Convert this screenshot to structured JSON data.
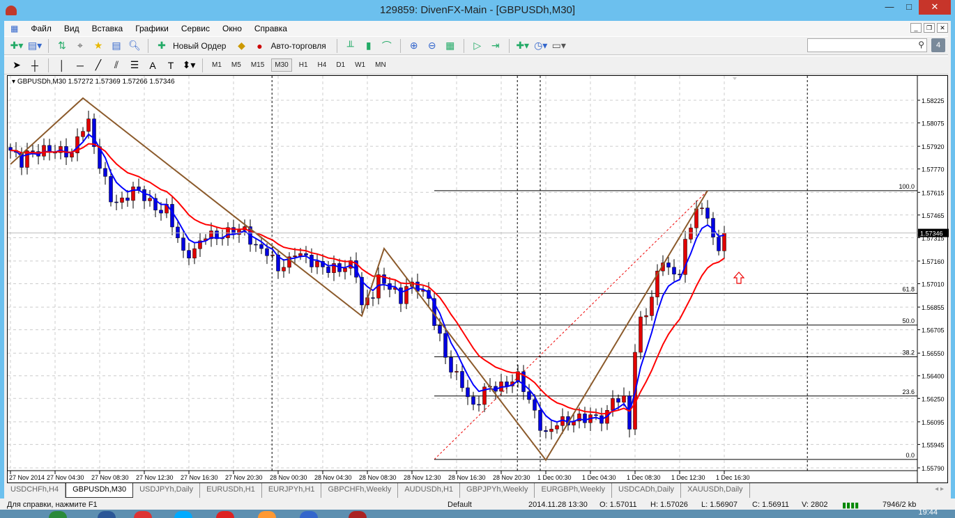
{
  "window": {
    "title": "129859: DivenFX-Main - [GBPUSDh,M30]",
    "minimize": "—",
    "maximize": "□",
    "close": "✕"
  },
  "menu": [
    "Файл",
    "Вид",
    "Вставка",
    "Графики",
    "Сервис",
    "Окно",
    "Справка"
  ],
  "toolbar": {
    "new_order": "Новый Ордер",
    "auto_trading": "Авто-торговля"
  },
  "timeframes": [
    "M1",
    "M5",
    "M15",
    "M30",
    "H1",
    "H4",
    "D1",
    "W1",
    "MN"
  ],
  "active_timeframe": "M30",
  "notification_count": "4",
  "chart_data": {
    "type": "candlestick",
    "symbol_legend": "GBPUSDh,M30  1.57272 1.57369 1.57266 1.57346",
    "current_price": "1.57346",
    "price_ticks": [
      "1.58225",
      "1.58075",
      "1.57920",
      "1.57770",
      "1.57615",
      "1.57465",
      "1.57315",
      "1.57160",
      "1.57010",
      "1.56855",
      "1.56705",
      "1.56550",
      "1.56400",
      "1.56250",
      "1.56095",
      "1.55945",
      "1.55790"
    ],
    "ylim": [
      1.5579,
      1.58225
    ],
    "time_ticks": [
      "27 Nov 2014",
      "27 Nov 04:30",
      "27 Nov 08:30",
      "27 Nov 12:30",
      "27 Nov 16:30",
      "27 Nov 20:30",
      "28 Nov 00:30",
      "28 Nov 04:30",
      "28 Nov 08:30",
      "28 Nov 12:30",
      "28 Nov 16:30",
      "28 Nov 20:30",
      "1 Dec 00:30",
      "1 Dec 04:30",
      "1 Dec 08:30",
      "1 Dec 12:30",
      "1 Dec 16:30"
    ],
    "close_keypoints": [
      [
        0,
        1.57893
      ],
      [
        2,
        1.57815
      ],
      [
        3,
        1.5787
      ],
      [
        6,
        1.57893
      ],
      [
        8,
        1.57893
      ],
      [
        11,
        1.5787
      ],
      [
        13,
        1.58054
      ],
      [
        14,
        1.58077
      ],
      [
        15,
        1.57916
      ],
      [
        17,
        1.57686
      ],
      [
        18,
        1.5757
      ],
      [
        20,
        1.57547
      ],
      [
        22,
        1.5764
      ],
      [
        24,
        1.57593
      ],
      [
        26,
        1.57501
      ],
      [
        28,
        1.57501
      ],
      [
        30,
        1.57317
      ],
      [
        31,
        1.57202
      ],
      [
        33,
        1.57225
      ],
      [
        35,
        1.5734
      ],
      [
        37,
        1.57317
      ],
      [
        40,
        1.57363
      ],
      [
        42,
        1.57363
      ],
      [
        44,
        1.57248
      ],
      [
        46,
        1.57225
      ],
      [
        48,
        1.57109
      ],
      [
        50,
        1.57155
      ],
      [
        51,
        1.57225
      ],
      [
        53,
        1.57179
      ],
      [
        55,
        1.57132
      ],
      [
        57,
        1.57109
      ],
      [
        59,
        1.57109
      ],
      [
        61,
        1.57132
      ],
      [
        62,
        1.57086
      ],
      [
        63,
        1.56856
      ],
      [
        65,
        1.56948
      ],
      [
        66,
        1.5704
      ],
      [
        68,
        1.56994
      ],
      [
        70,
        1.56902
      ],
      [
        71,
        1.56994
      ],
      [
        73,
        1.56994
      ],
      [
        75,
        1.56902
      ],
      [
        76,
        1.56764
      ],
      [
        78,
        1.56533
      ],
      [
        79,
        1.56441
      ],
      [
        81,
        1.56349
      ],
      [
        82,
        1.56257
      ],
      [
        83,
        1.56187
      ],
      [
        85,
        1.56303
      ],
      [
        86,
        1.56326
      ],
      [
        88,
        1.56326
      ],
      [
        90,
        1.56372
      ],
      [
        91,
        1.56395
      ],
      [
        92,
        1.56326
      ],
      [
        93,
        1.56233
      ],
      [
        95,
        1.56072
      ],
      [
        96,
        1.56003
      ],
      [
        97,
        1.56049
      ],
      [
        98,
        1.56095
      ],
      [
        100,
        1.56095
      ],
      [
        102,
        1.56118
      ],
      [
        104,
        1.56127
      ],
      [
        106,
        1.56118
      ],
      [
        107,
        1.56141
      ],
      [
        108,
        1.56257
      ],
      [
        110,
        1.56233
      ],
      [
        111,
        1.56072
      ],
      [
        112,
        1.56556
      ],
      [
        113,
        1.56764
      ],
      [
        115,
        1.56902
      ],
      [
        116,
        1.57086
      ],
      [
        117,
        1.57179
      ],
      [
        118,
        1.57086
      ],
      [
        120,
        1.57086
      ],
      [
        121,
        1.57271
      ],
      [
        122,
        1.57409
      ],
      [
        123,
        1.57501
      ],
      [
        125,
        1.57478
      ],
      [
        126,
        1.57294
      ],
      [
        127,
        1.57225
      ],
      [
        128,
        1.57346
      ]
    ],
    "zigzag": [
      [
        0,
        1.57801
      ],
      [
        13,
        1.58239
      ],
      [
        63,
        1.56796
      ],
      [
        67,
        1.57243
      ],
      [
        96,
        1.55842
      ],
      [
        125,
        1.57626
      ]
    ],
    "fibonacci": {
      "from": [
        76,
        1.55846
      ],
      "to": [
        125,
        1.57626
      ],
      "levels": [
        "0.0",
        "23.6",
        "38.2",
        "50.0",
        "61.8",
        "100.0"
      ]
    },
    "period_separators": [
      46.9,
      90.9,
      95,
      142.9
    ],
    "colors": {
      "bull": "#e00000",
      "bear": "#0000e0",
      "ma_fast": "#0000ff",
      "ma_slow": "#ff0000",
      "zigzag": "#8b5a2b",
      "fib": "#000000"
    }
  },
  "tabs": [
    "USDCHFh,H4",
    "GBPUSDh,M30",
    "USDJPYh,Daily",
    "EURUSDh,H1",
    "EURJPYh,H1",
    "GBPCHFh,Weekly",
    "AUDUSDh,H1",
    "GBPJPYh,Weekly",
    "EURGBPh,Weekly",
    "USDCADh,Daily",
    "XAUUSDh,Daily"
  ],
  "active_tab": "GBPUSDh,M30",
  "status": {
    "help": "Для справки, нажмите F1",
    "profile": "Default",
    "time": "2014.11.28 13:30",
    "open": "O: 1.57011",
    "high": "H: 1.57026",
    "low": "L: 1.56907",
    "close": "C: 1.56911",
    "volume": "V: 2802",
    "traffic": "7946/2 kb"
  },
  "clock": "19:44"
}
